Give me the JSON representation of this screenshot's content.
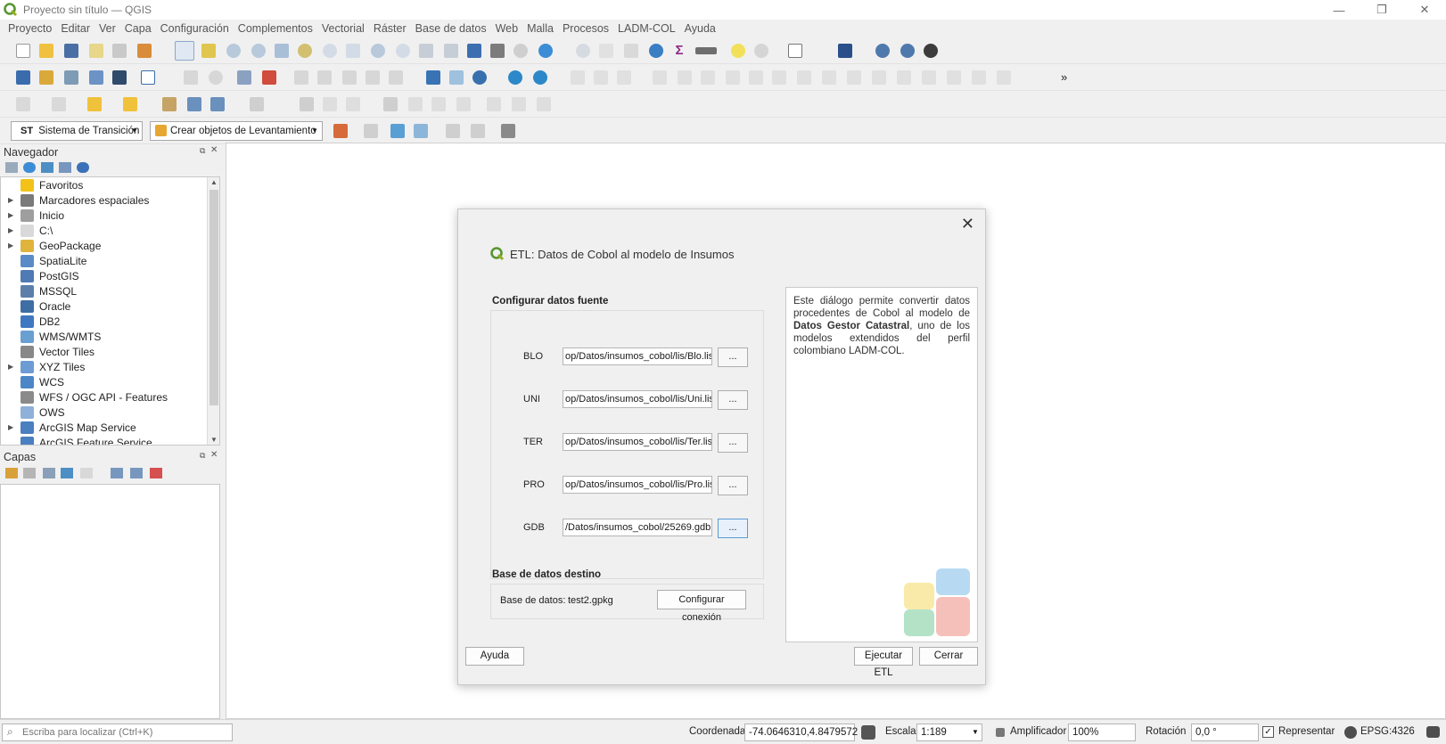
{
  "window": {
    "title": "Proyecto sin título — QGIS",
    "controls": {
      "minimize": "—",
      "restore": "❐",
      "close": "✕"
    }
  },
  "menubar": [
    "Proyecto",
    "Editar",
    "Ver",
    "Capa",
    "Configuración",
    "Complementos",
    "Vectorial",
    "Ráster",
    "Base de datos",
    "Web",
    "Malla",
    "Procesos",
    "LADM-COL",
    "Ayuda"
  ],
  "toolbar4": {
    "st_prefix": "ST",
    "st_label": "Sistema de Transición",
    "crear_label": "Crear objetos de Levantamiento"
  },
  "navigator": {
    "title": "Navegador",
    "items": [
      {
        "label": "Favoritos",
        "expand": false,
        "icon": "star-icon",
        "color": "#f2c218"
      },
      {
        "label": "Marcadores espaciales",
        "expand": true,
        "icon": "bookmark-icon",
        "color": "#7a7a7a"
      },
      {
        "label": "Inicio",
        "expand": true,
        "icon": "home-folder-icon",
        "color": "#9e9e9e"
      },
      {
        "label": "C:\\",
        "expand": true,
        "icon": "drive-folder-icon",
        "color": "#d9d9d9"
      },
      {
        "label": "GeoPackage",
        "expand": true,
        "icon": "geopackage-icon",
        "color": "#e0b33c"
      },
      {
        "label": "SpatiaLite",
        "expand": false,
        "icon": "spatialite-icon",
        "color": "#5a8bc7"
      },
      {
        "label": "PostGIS",
        "expand": false,
        "icon": "postgis-icon",
        "color": "#4f7ab3"
      },
      {
        "label": "MSSQL",
        "expand": false,
        "icon": "mssql-icon",
        "color": "#5b7fa8"
      },
      {
        "label": "Oracle",
        "expand": false,
        "icon": "oracle-icon",
        "color": "#3e6ea3"
      },
      {
        "label": "DB2",
        "expand": false,
        "icon": "db2-icon",
        "color": "#3f77c1"
      },
      {
        "label": "WMS/WMTS",
        "expand": false,
        "icon": "globe-icon",
        "color": "#6a9fd1"
      },
      {
        "label": "Vector Tiles",
        "expand": false,
        "icon": "vector-tiles-icon",
        "color": "#888888"
      },
      {
        "label": "XYZ Tiles",
        "expand": true,
        "icon": "xyz-tiles-icon",
        "color": "#6d9bd4"
      },
      {
        "label": "WCS",
        "expand": false,
        "icon": "wcs-globe-icon",
        "color": "#4d86c6"
      },
      {
        "label": "WFS / OGC API - Features",
        "expand": false,
        "icon": "wfs-icon",
        "color": "#8a8a8a"
      },
      {
        "label": "OWS",
        "expand": false,
        "icon": "ows-globe-icon",
        "color": "#8fb1d9"
      },
      {
        "label": "ArcGIS Map Service",
        "expand": true,
        "icon": "arcgis-map-icon",
        "color": "#4a7fc0"
      },
      {
        "label": "ArcGIS Feature Service",
        "expand": false,
        "icon": "arcgis-feature-icon",
        "color": "#4a7fc0"
      }
    ]
  },
  "layers": {
    "title": "Capas"
  },
  "dialog": {
    "title": "ETL: Datos de Cobol al modelo de Insumos",
    "source_section": "Configurar datos fuente",
    "fields": [
      {
        "label": "BLO",
        "value": "op/Datos/insumos_cobol/lis/Blo.lis",
        "browse": "..."
      },
      {
        "label": "UNI",
        "value": "op/Datos/insumos_cobol/lis/Uni.lis",
        "browse": "..."
      },
      {
        "label": "TER",
        "value": "op/Datos/insumos_cobol/lis/Ter.lis",
        "browse": "..."
      },
      {
        "label": "PRO",
        "value": "op/Datos/insumos_cobol/lis/Pro.lis",
        "browse": "..."
      },
      {
        "label": "GDB",
        "value": "/Datos/insumos_cobol/25269.gdb",
        "browse": "..."
      }
    ],
    "dest_section": "Base de datos destino",
    "db_label": "Base de datos:",
    "db_value": "test2.gpkg",
    "config_button": "Configurar conexión",
    "help_text_1": "Este diálogo permite convertir datos procedentes de Cobol al modelo de ",
    "help_bold": "Datos Gestor Catastral",
    "help_text_2": ", uno de los modelos extendidos del perfil colombiano LADM-COL.",
    "help_button": "Ayuda",
    "run_button": "Ejecutar ETL",
    "close_button": "Cerrar"
  },
  "statusbar": {
    "locator_placeholder": "Escriba para localizar (Ctrl+K)",
    "coord_label": "Coordenada",
    "coord_value": "-74.0646310,4.8479572",
    "scale_label": "Escala",
    "scale_value": "1:189",
    "magnifier_label": "Amplificador",
    "magnifier_value": "100%",
    "rotation_label": "Rotación",
    "rotation_value": "0,0 °",
    "render_label": "Representar",
    "crs_label": "EPSG:4326"
  }
}
